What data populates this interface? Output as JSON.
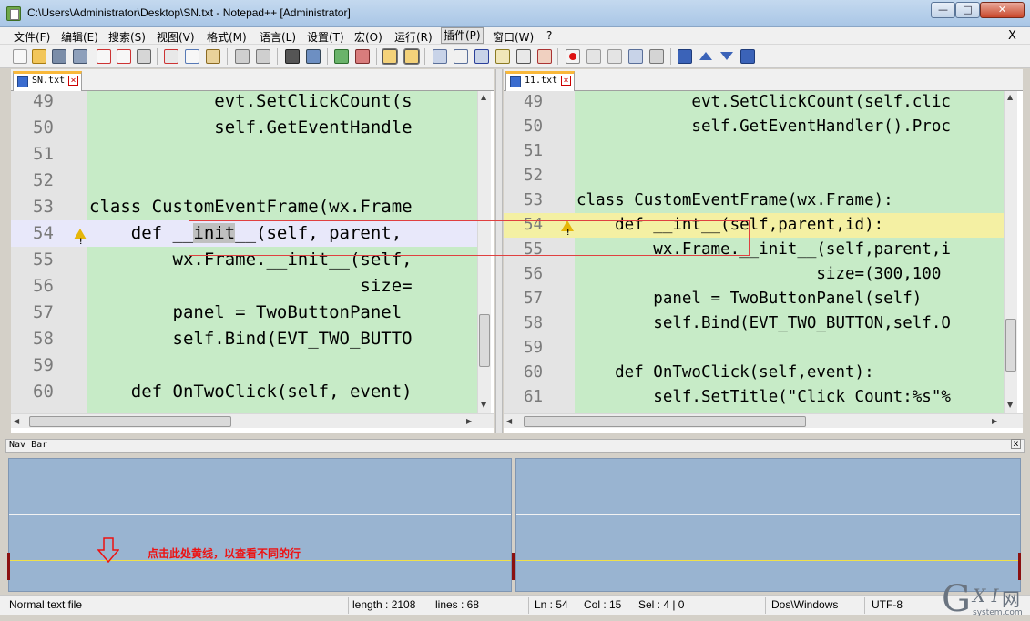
{
  "window": {
    "title": "C:\\Users\\Administrator\\Desktop\\SN.txt - Notepad++ [Administrator]",
    "min": "—",
    "max": "□",
    "close": "✕"
  },
  "menu": {
    "items": [
      "文件(F)",
      "编辑(E)",
      "搜索(S)",
      "视图(V)",
      "格式(M)",
      "语言(L)",
      "设置(T)",
      "宏(O)",
      "运行(R)",
      "插件(P)",
      "窗口(W)",
      "?"
    ],
    "close": "X"
  },
  "left_editor": {
    "tab_label": "SN.txt",
    "lines": [
      {
        "num": "49",
        "text": "            evt.SetClickCount(s"
      },
      {
        "num": "50",
        "text": "            self.GetEventHandle"
      },
      {
        "num": "51",
        "text": ""
      },
      {
        "num": "52",
        "text": ""
      },
      {
        "num": "53",
        "text": "class CustomEventFrame(wx.Frame"
      },
      {
        "num": "54",
        "text": "    def __init__(self, parent,"
      },
      {
        "num": "55",
        "text": "        wx.Frame.__init__(self,"
      },
      {
        "num": "56",
        "text": "                          size="
      },
      {
        "num": "57",
        "text": "        panel = TwoButtonPanel "
      },
      {
        "num": "58",
        "text": "        self.Bind(EVT_TWO_BUTTO"
      },
      {
        "num": "59",
        "text": ""
      },
      {
        "num": "60",
        "text": "    def OnTwoClick(self, event)"
      }
    ]
  },
  "right_editor": {
    "tab_label": "11.txt",
    "lines": [
      {
        "num": "49",
        "text": "            evt.SetClickCount(self.clic"
      },
      {
        "num": "50",
        "text": "            self.GetEventHandler().Proc"
      },
      {
        "num": "51",
        "text": ""
      },
      {
        "num": "52",
        "text": ""
      },
      {
        "num": "53",
        "text": "class CustomEventFrame(wx.Frame):"
      },
      {
        "num": "54",
        "text": "    def __int__(self,parent,id):"
      },
      {
        "num": "55",
        "text": "        wx.Frame.__init__(self,parent,i"
      },
      {
        "num": "56",
        "text": "                         size=(300,100"
      },
      {
        "num": "57",
        "text": "        panel = TwoButtonPanel(self)"
      },
      {
        "num": "58",
        "text": "        self.Bind(EVT_TWO_BUTTON,self.O"
      },
      {
        "num": "59",
        "text": ""
      },
      {
        "num": "60",
        "text": "    def OnTwoClick(self,event):"
      },
      {
        "num": "61",
        "text": "        self.SetTitle(\"Click Count:%s\"%"
      }
    ]
  },
  "nav_bar": {
    "label": "Nav Bar",
    "close": "x",
    "hint": "点击此处黄线，以查看不同的行"
  },
  "status": {
    "file_type": "Normal text file",
    "length": "length : 2108",
    "lines": "lines : 68",
    "ln": "Ln : 54",
    "col": "Col : 15",
    "sel": "Sel : 4 | 0",
    "eol": "Dos\\Windows",
    "encoding": "UTF-8"
  },
  "watermark": {
    "g": "G",
    "xi": "X I",
    "wang": "网",
    "sub": "system.com"
  },
  "colors": {
    "diff_green": "#c7ebc7",
    "current_line": "#e8e8fa",
    "changed_line": "#f4f0a3",
    "annotation_red": "#e04040",
    "hint_red": "#e11111",
    "nav_blue": "#99b4d1"
  }
}
